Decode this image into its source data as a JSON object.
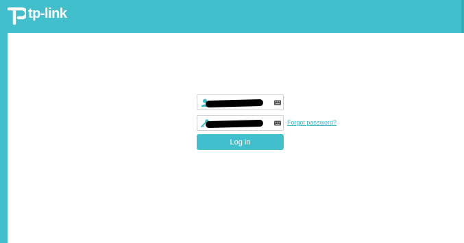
{
  "header": {
    "brand": "tp-link",
    "logo_icon": "tp-link-logo-icon"
  },
  "login_form": {
    "username": {
      "icon": "user-icon",
      "value": "",
      "keyboard_icon": "keyboard-icon"
    },
    "password": {
      "icon": "key-icon",
      "value": "",
      "keyboard_icon": "keyboard-icon"
    },
    "forgot_password": "Forgot password?",
    "login_button": "Log in"
  },
  "colors": {
    "brand": "#42bfcd",
    "background": "#ffffff",
    "link": "#3cb6c4"
  }
}
